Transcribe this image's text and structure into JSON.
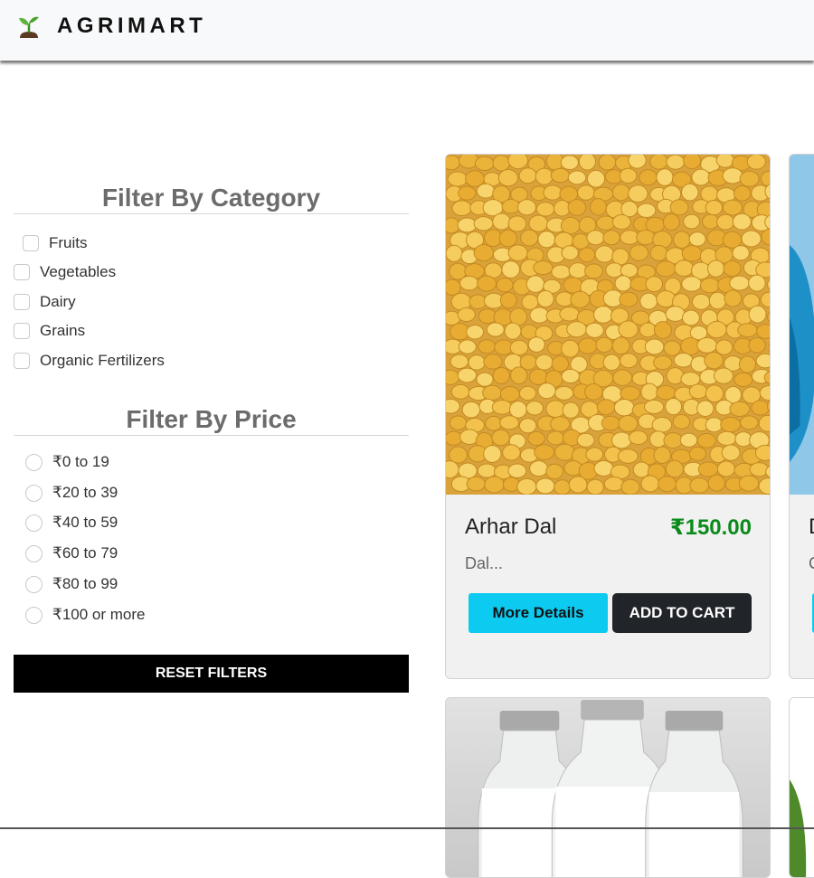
{
  "brand": {
    "name": "AGRIMART",
    "icon": "sprout-icon"
  },
  "filters": {
    "category_title": "Filter By Category",
    "categories": [
      "Fruits",
      "Vegetables",
      "Dairy",
      "Grains",
      "Organic Fertilizers"
    ],
    "price_title": "Filter By Price",
    "prices": [
      "₹0 to 19",
      "₹20 to 39",
      "₹40 to 59",
      "₹60 to 79",
      "₹80 to 99",
      "₹100 or more"
    ],
    "reset_label": "RESET FILTERS"
  },
  "products": [
    {
      "name": "Arhar Dal",
      "price": "₹150.00",
      "desc": "Dal...",
      "details_label": "More Details",
      "cart_label": "ADD TO CART",
      "image": "yellow-lentils-photo"
    }
  ],
  "partial_card": {
    "name_initial": "D",
    "desc_initial": "C",
    "image": "blue-bottle-photo"
  },
  "colors": {
    "navbar_bg": "#f8f9fa",
    "price_green": "#0a8a1a",
    "details_button": "#0dcaf0",
    "cart_button": "#212529",
    "reset_button": "#000000"
  }
}
